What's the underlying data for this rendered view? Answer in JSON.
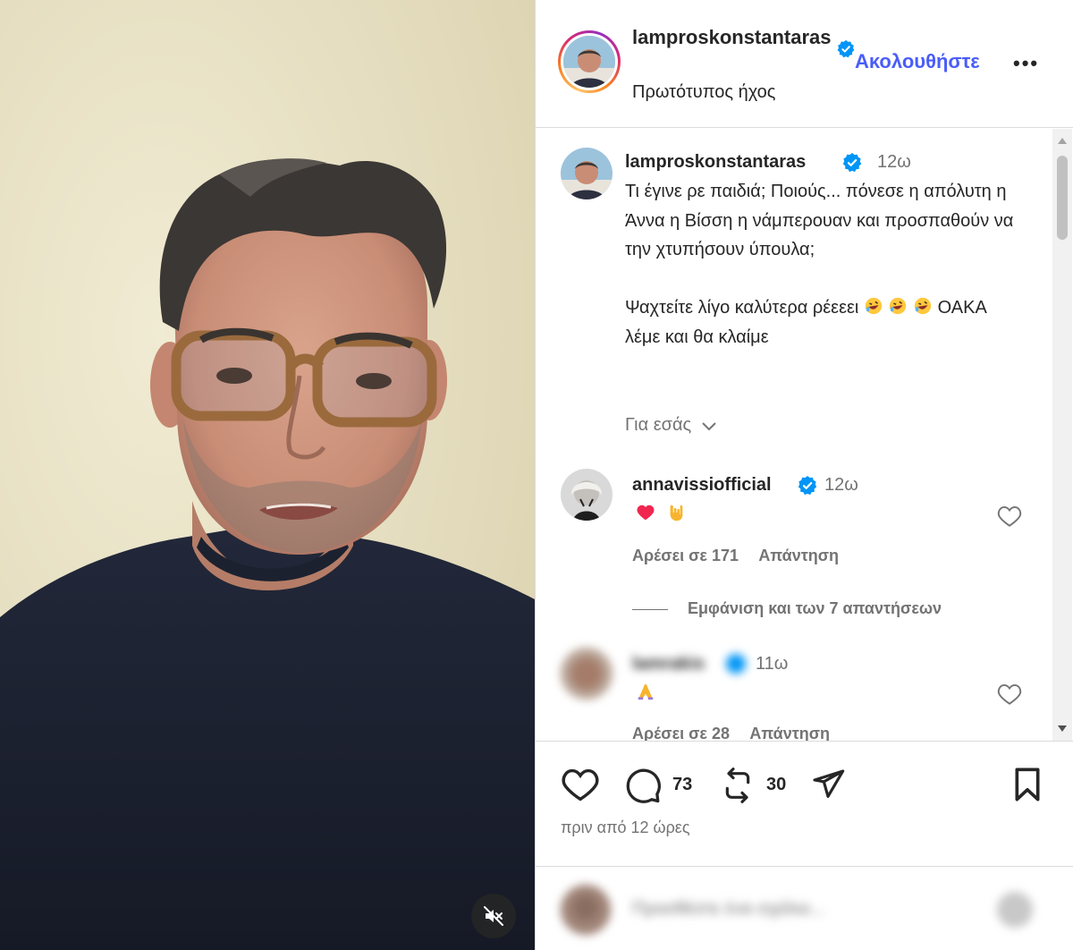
{
  "header": {
    "username": "lamproskonstantaras",
    "follow_label": "Ακολουθήστε",
    "more_label": "•••",
    "audio_label": "Πρωτότυπος ήχος"
  },
  "caption": {
    "username": "lamproskonstantaras",
    "time": "12ω",
    "paragraph1": "Τι έγινε ρε παιδιά; Ποιούς... πόνεσε η απόλυτη η Άννα η Βίσση η νάμπερουαν και προσπαθούν να την χτυπήσουν ύπουλα;",
    "paragraph2_a": "Ψαχτείτε λίγο καλύτερα ρέεεει",
    "paragraph2_b": "ΟΑΚΑ λέμε και θα κλαίμε",
    "for_you": "Για εσάς"
  },
  "comments": [
    {
      "username": "annavissiofficial",
      "time": "12ω",
      "likes": "Αρέσει σε 171",
      "reply": "Απάντηση"
    },
    {
      "username": "lamrakis",
      "time": "11ω",
      "likes": "Αρέσει σε 28",
      "reply": "Απάντηση"
    }
  ],
  "view_replies": "Εμφάνιση και των 7 απαντήσεων",
  "actions": {
    "comment_count": "73",
    "repost_count": "30",
    "timestamp": "πριν από 12 ώρες"
  },
  "add_comment": {
    "placeholder": "Προσθέστε ένα σχόλιο..."
  },
  "colors": {
    "accent": "#4a5df9",
    "verified": "#0095f6",
    "text": "#262626",
    "secondary": "#737373"
  }
}
